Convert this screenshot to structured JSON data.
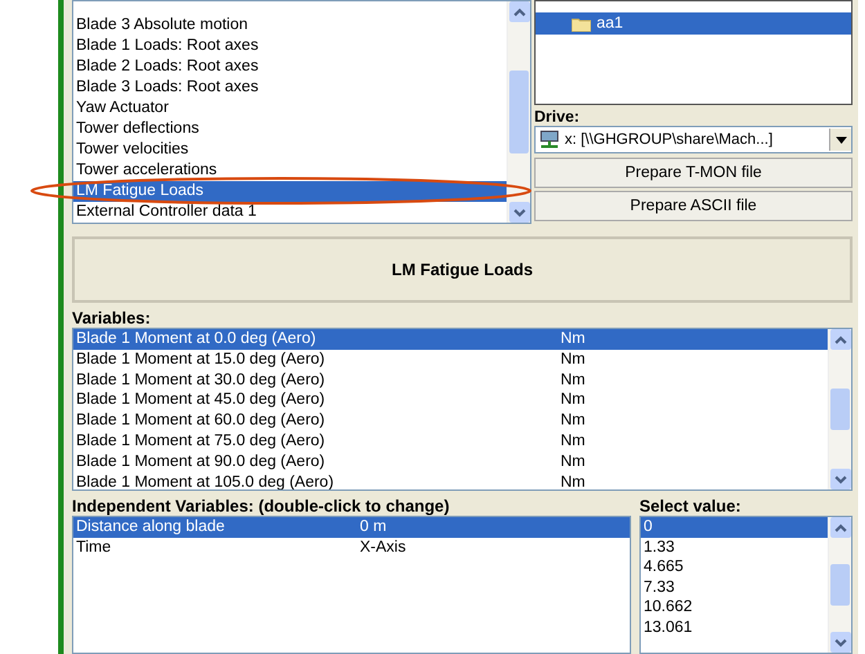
{
  "topics": [
    {
      "label": "Blade 3 Absolute motion",
      "selected": false
    },
    {
      "label": "Blade 1 Loads: Root axes",
      "selected": false
    },
    {
      "label": "Blade 2 Loads: Root axes",
      "selected": false
    },
    {
      "label": "Blade 3 Loads: Root axes",
      "selected": false
    },
    {
      "label": "Yaw Actuator",
      "selected": false
    },
    {
      "label": "Tower deflections",
      "selected": false
    },
    {
      "label": "Tower velocities",
      "selected": false
    },
    {
      "label": "Tower accelerations",
      "selected": false
    },
    {
      "label": "LM Fatigue Loads",
      "selected": true
    },
    {
      "label": "External Controller data 1",
      "selected": false
    }
  ],
  "folders": [
    {
      "label": "aa1",
      "selected": true
    }
  ],
  "drive": {
    "label": "Drive:",
    "value": "x: [\\\\GHGROUP\\share\\Mach...]"
  },
  "buttons": [
    "Prepare T-MON file",
    "Prepare ASCII file"
  ],
  "dataset_title": "LM Fatigue Loads",
  "variables": {
    "label": "Variables:",
    "rows": [
      {
        "name": "Blade 1 Moment at 0.0 deg (Aero)",
        "unit": "Nm",
        "selected": true
      },
      {
        "name": "Blade 1 Moment at 15.0 deg (Aero)",
        "unit": "Nm",
        "selected": false
      },
      {
        "name": "Blade 1 Moment at 30.0 deg (Aero)",
        "unit": "Nm",
        "selected": false
      },
      {
        "name": "Blade 1 Moment at 45.0 deg (Aero)",
        "unit": "Nm",
        "selected": false
      },
      {
        "name": "Blade 1 Moment at 60.0 deg (Aero)",
        "unit": "Nm",
        "selected": false
      },
      {
        "name": "Blade 1 Moment at 75.0 deg (Aero)",
        "unit": "Nm",
        "selected": false
      },
      {
        "name": "Blade 1 Moment at 90.0 deg (Aero)",
        "unit": "Nm",
        "selected": false
      },
      {
        "name": "Blade 1 Moment at 105.0 deg (Aero)",
        "unit": "Nm",
        "selected": false
      }
    ]
  },
  "independent": {
    "label": "Independent Variables: (double-click to change)",
    "rows": [
      {
        "name": "Distance along blade",
        "value": "0 m",
        "selected": true
      },
      {
        "name": "Time",
        "value": "X-Axis",
        "selected": false
      }
    ]
  },
  "select_value": {
    "label": "Select value:",
    "items": [
      {
        "label": "0",
        "selected": true
      },
      {
        "label": "1.33",
        "selected": false
      },
      {
        "label": "4.665",
        "selected": false
      },
      {
        "label": "7.33",
        "selected": false
      },
      {
        "label": "10.662",
        "selected": false
      },
      {
        "label": "13.061",
        "selected": false
      }
    ]
  }
}
